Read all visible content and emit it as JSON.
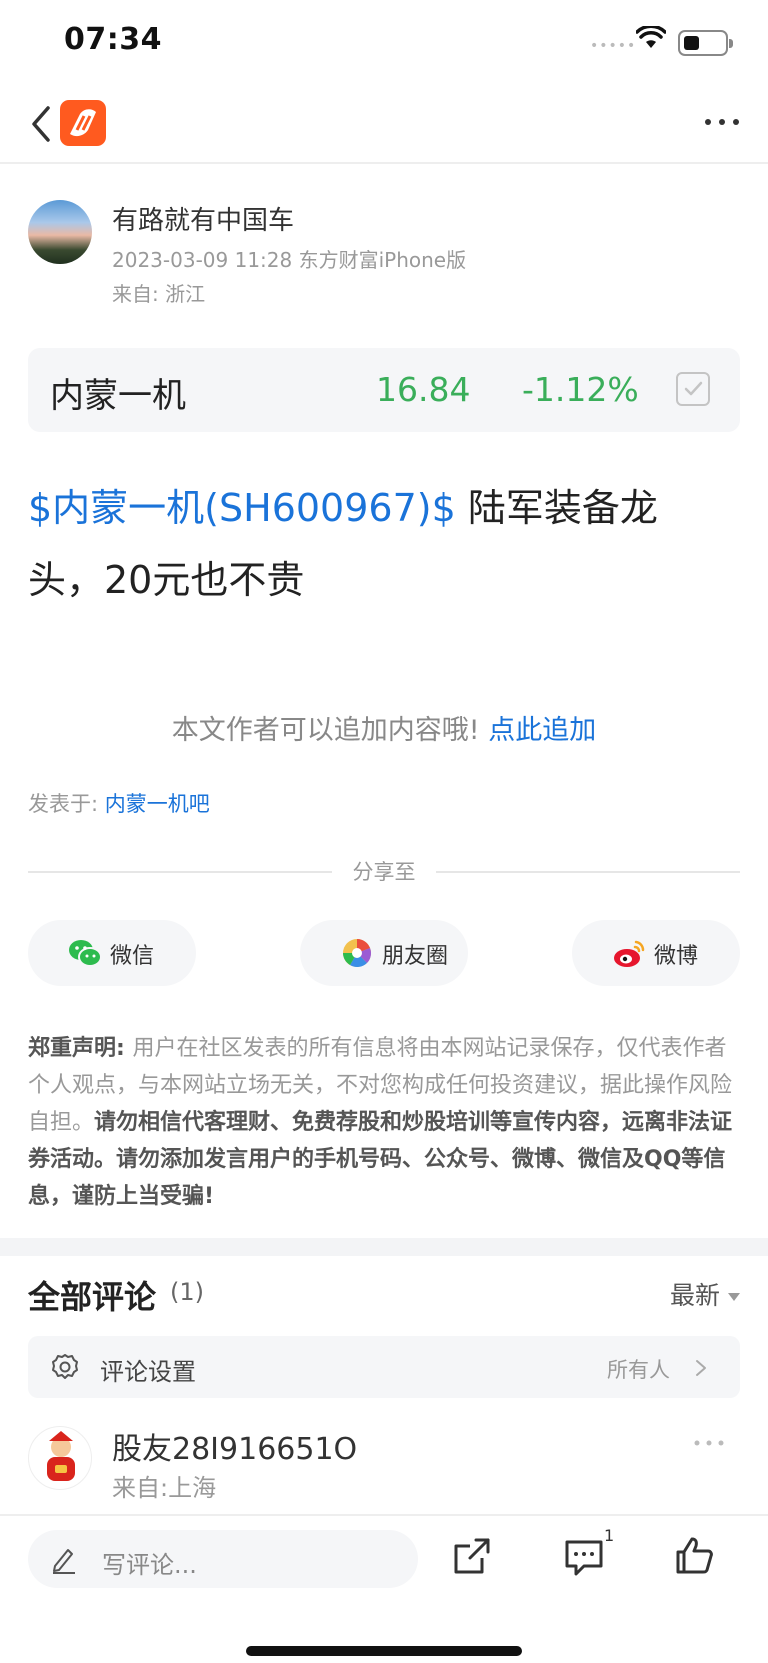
{
  "status_bar": {
    "time": "07:34",
    "signal_dots": "•••••"
  },
  "author": {
    "name": "有路就有中国车",
    "meta": "2023-03-09 11:28 东方财富iPhone版",
    "location": "来自: 浙江"
  },
  "stock_card": {
    "name": "内蒙一机",
    "price": "16.84",
    "change": "-1.12%"
  },
  "post": {
    "stock_tag": "$内蒙一机(SH600967)$",
    "text": " 陆军装备龙头，20元也不贵"
  },
  "append": {
    "hint": "本文作者可以追加内容哦! ",
    "link": "点此追加"
  },
  "posted_in": {
    "label": "发表于: ",
    "forum": "内蒙一机吧"
  },
  "share": {
    "label": "分享至",
    "wechat": "微信",
    "moments": "朋友圈",
    "weibo": "微博"
  },
  "disclaimer": {
    "title": "郑重声明: ",
    "normal": "用户在社区发表的所有信息将由本网站记录保存，仅代表作者个人观点，与本网站立场无关，不对您构成任何投资建议，据此操作风险自担。",
    "bold": "请勿相信代客理财、免费荐股和炒股培训等宣传内容，远离非法证券活动。请勿添加发言用户的手机号码、公众号、微博、微信及QQ等信息，谨防上当受骗!"
  },
  "comments": {
    "title": "全部评论",
    "count": "(1)",
    "sort": "最新",
    "settings_label": "评论设置",
    "settings_value": "所有人",
    "items": [
      {
        "user": "股友28I916651O",
        "location": "来自:上海"
      }
    ]
  },
  "bottom_bar": {
    "input_placeholder": "写评论...",
    "comment_badge": "1"
  },
  "colors": {
    "link": "#1a73d9",
    "stock_down": "#3aae5a",
    "brand": "#ff5a1f"
  }
}
